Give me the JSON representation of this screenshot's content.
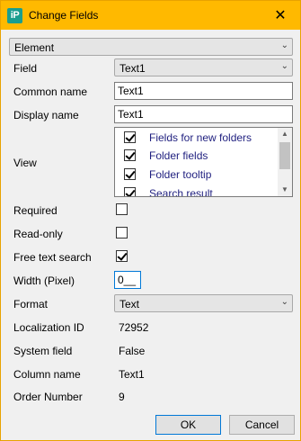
{
  "window": {
    "title": "Change Fields",
    "app_icon": "iP",
    "close_glyph": "✕"
  },
  "element_select": {
    "value": "Element"
  },
  "labels": {
    "field": "Field",
    "common_name": "Common name",
    "display_name": "Display name",
    "view": "View",
    "required": "Required",
    "read_only": "Read-only",
    "free_text_search": "Free text search",
    "width": "Width (Pixel)",
    "format": "Format",
    "localization_id": "Localization ID",
    "system_field": "System field",
    "column_name": "Column name",
    "order_number": "Order Number"
  },
  "field_select": {
    "value": "Text1"
  },
  "common_name_input": {
    "value": "Text1"
  },
  "display_name_input": {
    "value": "Text1"
  },
  "view_list": [
    {
      "label": "Fields for new folders",
      "checked": true
    },
    {
      "label": "Folder fields",
      "checked": true
    },
    {
      "label": "Folder tooltip",
      "checked": true
    },
    {
      "label": "Search result",
      "checked": true
    }
  ],
  "required": {
    "checked": false
  },
  "read_only": {
    "checked": false
  },
  "free_text_search": {
    "checked": true
  },
  "width_input": {
    "value": "0__"
  },
  "format_select": {
    "value": "Text"
  },
  "values": {
    "localization_id": "72952",
    "system_field": "False",
    "column_name": "Text1",
    "order_number": "9"
  },
  "buttons": {
    "ok": "OK",
    "cancel": "Cancel"
  }
}
